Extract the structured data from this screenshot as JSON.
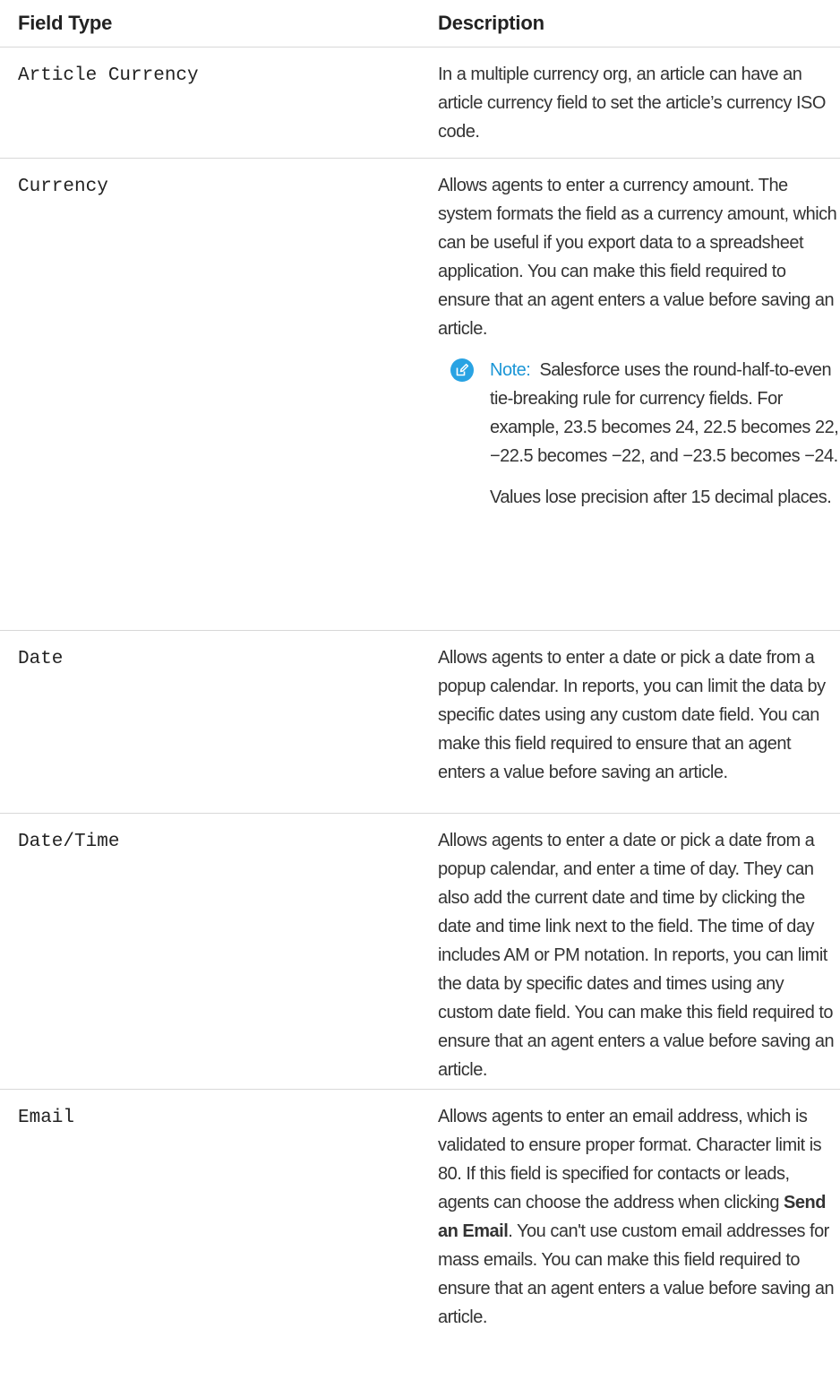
{
  "table": {
    "headers": {
      "field_type": "Field Type",
      "description": "Description"
    },
    "rows": [
      {
        "field_type": "Article Currency",
        "description": "In a multiple currency org, an article can have an article currency field to set the article’s currency ISO code."
      },
      {
        "field_type": "Currency",
        "description": "Allows agents to enter a currency amount. The system formats the field as a currency amount, which can be useful if you export data to a spreadsheet application. You can make this field required to ensure that an agent enters a value before saving an article.",
        "note_label": "Note:",
        "note_text": "Salesforce uses the round-half-to-even tie-breaking rule for currency fields. For example, 23.5 becomes 24, 22.5 becomes 22, −22.5 becomes −22, and −23.5 becomes −24.",
        "note_text2": "Values lose precision after 15 decimal places."
      },
      {
        "field_type": "Date",
        "description": "Allows agents to enter a date or pick a date from a popup calendar. In reports, you can limit the data by specific dates using any custom date field. You can make this field required to ensure that an agent enters a value before saving an article."
      },
      {
        "field_type": "Date/Time",
        "description": "Allows agents to enter a date or pick a date from a popup calendar, and enter a time of day. They can also add the current date and time by clicking the date and time link next to the field. The time of day includes AM or PM notation. In reports, you can limit the data by specific dates and times using any custom date field. You can make this field required to ensure that an agent enters a value before saving an article."
      },
      {
        "field_type": "Email",
        "description_before": "Allows agents to enter an email address, which is validated to ensure proper format. Character limit is 80. If this field is specified for contacts or leads, agents can choose the address when clicking",
        "description_bold": "Send an Email",
        "description_after": ". You can't use custom email addresses for mass emails. You can make this field required to ensure that an agent enters a value before saving an article."
      }
    ]
  },
  "colors": {
    "note_icon": "#29a3e3",
    "note_label": "#1b96d6",
    "divider": "#d8d8d8"
  }
}
